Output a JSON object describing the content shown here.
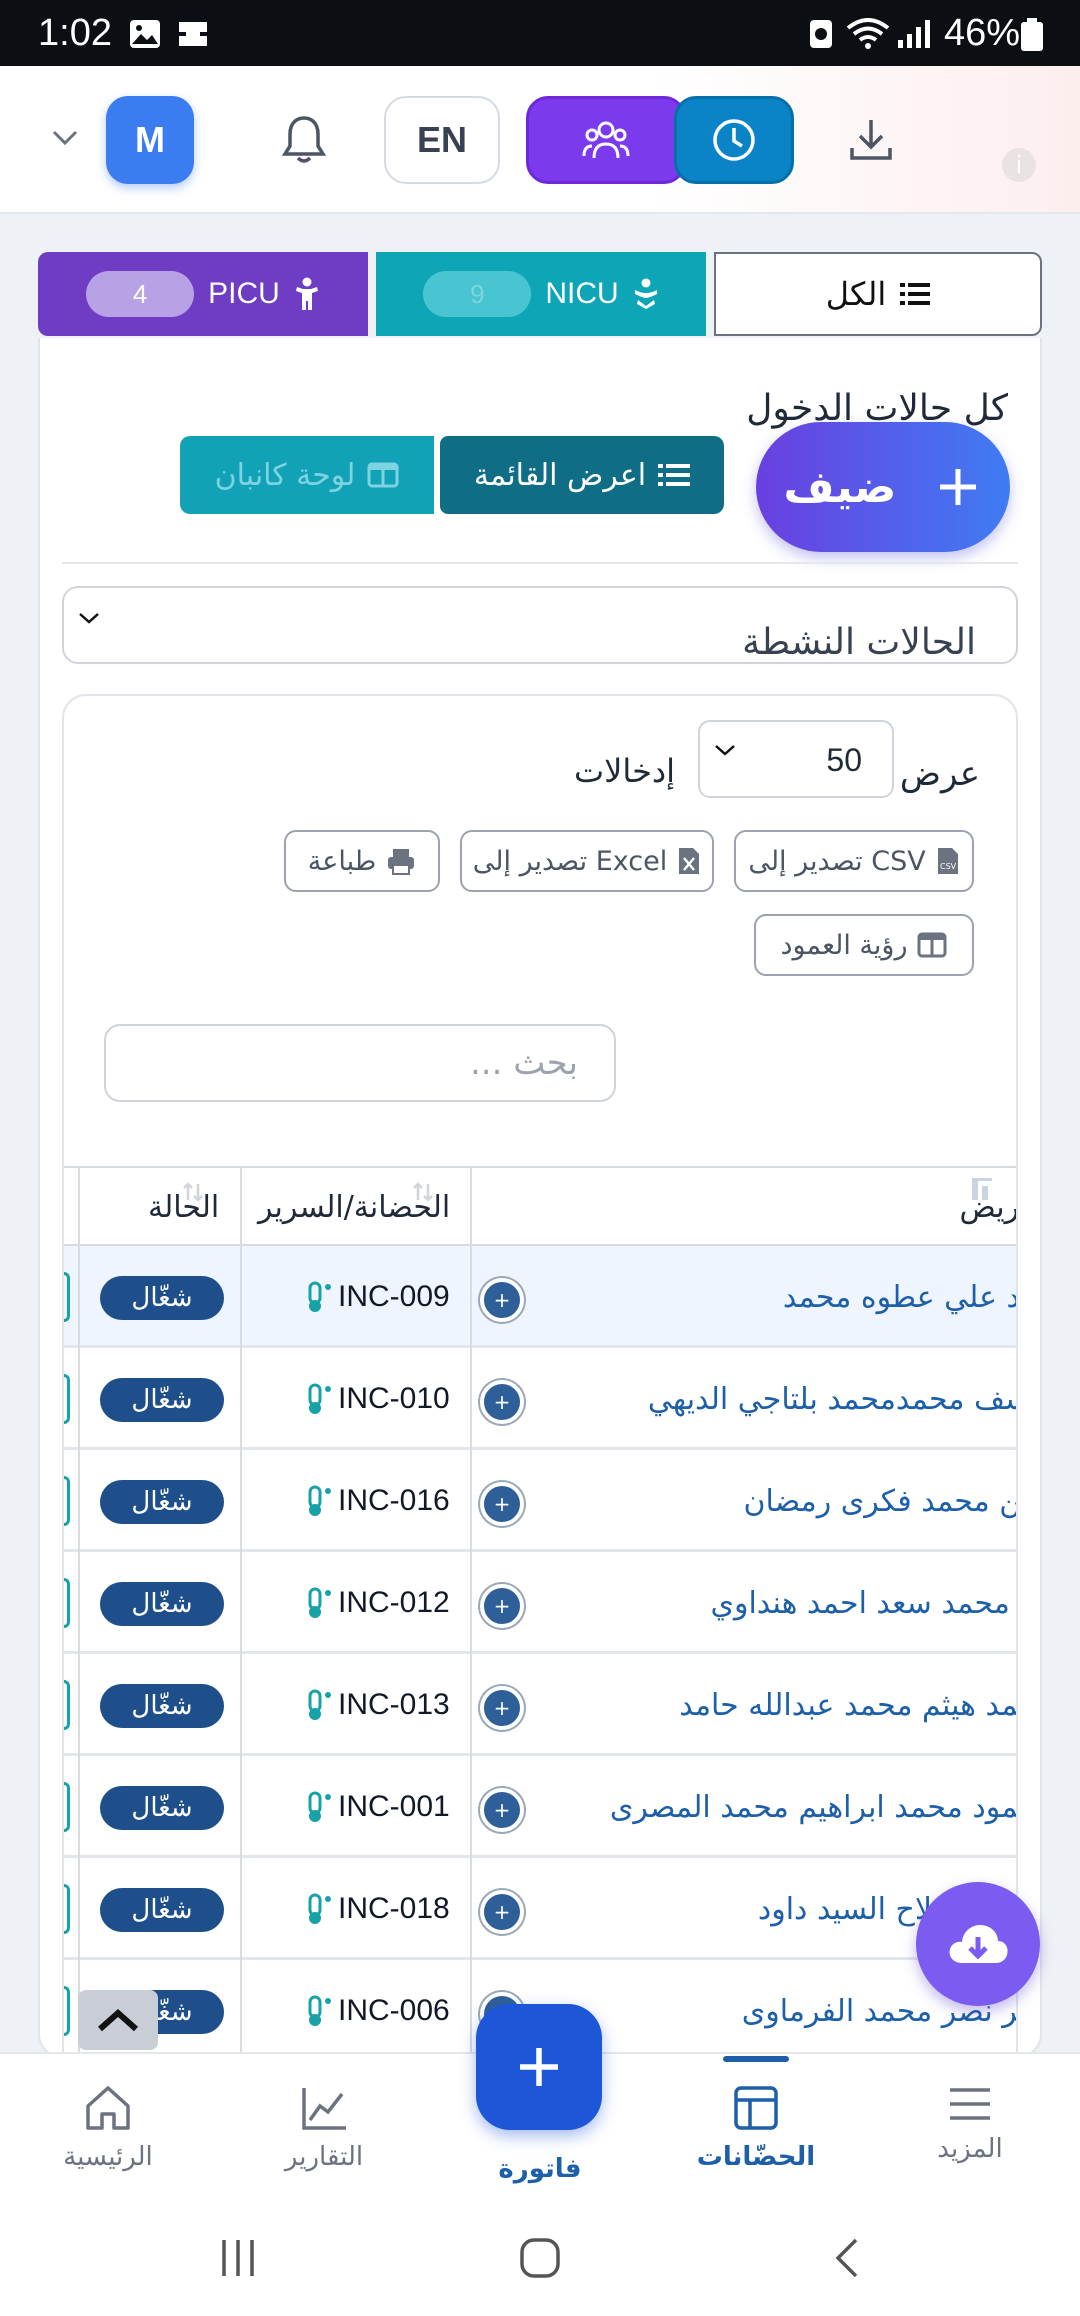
{
  "status_bar": {
    "time": "1:02",
    "battery": "46%"
  },
  "header": {
    "avatar_letter": "M",
    "language": "EN"
  },
  "tabs": [
    {
      "label": "PICU",
      "count": "4"
    },
    {
      "label": "NICU",
      "count": "9"
    },
    {
      "label": "الكل"
    }
  ],
  "section": {
    "title": "كل حالات الدخول",
    "add_label": "ضيف",
    "list_view_label": "اعرض القائمة",
    "kanban_label": "لوحة كانبان",
    "filter_value": "الحالات النشطة"
  },
  "table_controls": {
    "show_label": "عرض",
    "entries_value": "50",
    "entries_label": "إدخالات",
    "csv_label": "تصدير إلى CSV",
    "excel_label": "تصدير إلى Excel",
    "print_label": "طباعة",
    "columns_label": "رؤية العمود",
    "search_placeholder": "بحث ..."
  },
  "table": {
    "headers": {
      "patient": "المريض",
      "bed": "الحضانة/السرير",
      "status": "الحالة"
    },
    "rows": [
      {
        "patient": "عهد علي عطوه محمد",
        "bed": "INC-009",
        "status": "شغّال"
      },
      {
        "patient": "يوسف محمدمحمد بلتاجي الديهي",
        "bed": "INC-010",
        "status": "شغّال"
      },
      {
        "patient": "وتين محمد فكرى رمضان",
        "bed": "INC-016",
        "status": "شغّال"
      },
      {
        "patient": "لانا محمد سعد احمد هنداوي",
        "bed": "INC-012",
        "status": "شغّال"
      },
      {
        "patient": "محمد هيثم محمد عبدالله حامد",
        "bed": "INC-013",
        "status": "شغّال"
      },
      {
        "patient": "محمود محمد ابراهيم محمد المصرى",
        "bed": "INC-001",
        "status": "شغّال"
      },
      {
        "patient": "عبدالله صلاح السيد داود",
        "bed": "INC-018",
        "status": "شغّال"
      },
      {
        "patient": "عمر نصر محمد الفرماوى",
        "bed": "INC-006",
        "status": "شغّال"
      }
    ]
  },
  "bottom_nav": {
    "more": "المزيد",
    "incubators": "الحضّانات",
    "invoice": "فاتورة",
    "reports": "التقارير",
    "home": "الرئيسية"
  },
  "colors": {
    "primary": "#1d5fa8",
    "picu": "#6f3cc4",
    "nicu": "#0ea5b7",
    "accent_purple": "#7c3aed"
  }
}
